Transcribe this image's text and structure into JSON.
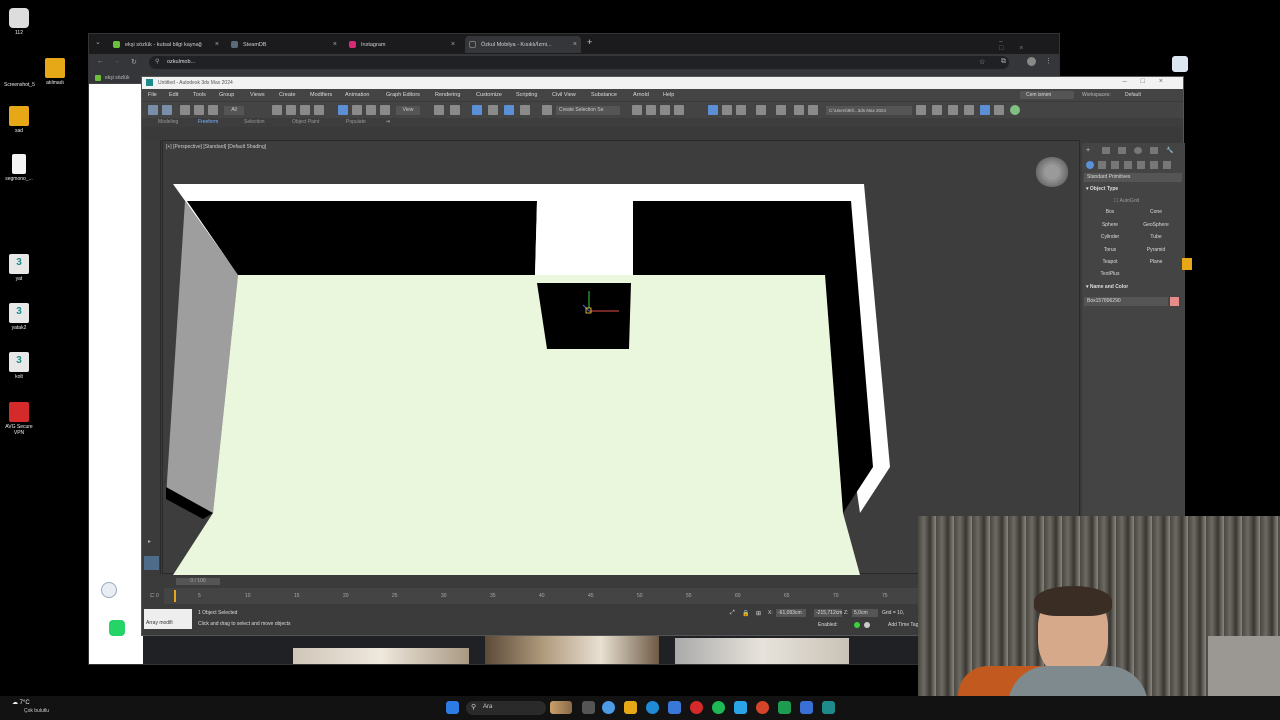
{
  "desktop": {
    "icons": [
      {
        "label": "112",
        "color": "#eeeeee"
      },
      {
        "label": "Screenshot_5",
        "color": "#ffffff"
      },
      {
        "label": "atılmadı",
        "color": "#e6a817"
      },
      {
        "label": "sad",
        "color": "#e6a817"
      },
      {
        "label": "segmono_...",
        "color": "#f4f4f4"
      },
      {
        "label": "yat",
        "color": "#1f8a8a"
      },
      {
        "label": "yatak2",
        "color": "#1f8a8a"
      },
      {
        "label": "kolt",
        "color": "#1f8a8a"
      },
      {
        "label": "AVG Secure VPN",
        "color": "#d42a2a"
      }
    ]
  },
  "browser": {
    "tabs": [
      {
        "label": "ekşi sözlük - kutsal bilgi kaynağ",
        "fav_color": "#6bbf3a"
      },
      {
        "label": "SteamDB",
        "fav_color": "#5b6a7a"
      },
      {
        "label": "Instagram",
        "fav_color": "#d62976"
      },
      {
        "label": "Özkul Mobilya - Kısıklı/İzmi...",
        "fav_color": "#333333"
      }
    ],
    "new_tab": "+",
    "address": "ozkulmob...",
    "bookmark": "ekşi sözlük"
  },
  "max": {
    "title": "Untitled - Autodesk 3ds Max 2024",
    "menus": [
      "File",
      "Edit",
      "Tools",
      "Group",
      "Views",
      "Create",
      "Modifiers",
      "Animation",
      "Graph Editors",
      "Rendering",
      "Customize",
      "Scripting",
      "Civil View",
      "Substance",
      "Arnold",
      "Help"
    ],
    "user": "Cem ismen",
    "workspaces_label": "Workspaces:",
    "workspace": "Default",
    "view_dropdown": "View",
    "selection_set": "Create Selection Se",
    "path": "C:\\Users\\90\\...3ds Max 2024",
    "ribbon_tabs": [
      "Modeling",
      "Freeform",
      "Selection",
      "Object Paint",
      "Populate"
    ],
    "viewport_label": "[+] [Perspective] [Standard] [Default Shading]",
    "panel": {
      "category": "Standard Primitives",
      "object_type": "Object Type",
      "autogrid": "AutoGrid",
      "primitives": [
        "Box",
        "Cone",
        "Sphere",
        "GeoSphere",
        "Cylinder",
        "Tube",
        "Torus",
        "Pyramid",
        "Teapot",
        "Plane",
        "TextPlus"
      ],
      "name_color": "Name and Color",
      "object_name": "Box157896290",
      "swatch_color": "#e88b8b"
    },
    "timeline": {
      "frame": "0 / 100",
      "ticks": [
        "0",
        "5",
        "10",
        "15",
        "20",
        "25",
        "30",
        "35",
        "40",
        "45",
        "50",
        "55",
        "60",
        "65",
        "70",
        "75"
      ]
    },
    "status": {
      "maxscript": "Array modifi",
      "selected": "1 Object Selected",
      "hint": "Click and drag to select and move objects",
      "x_label": "X:",
      "x_value": "-61,093cm",
      "y_value": "-215,712cm",
      "z_label": "Z:",
      "z_value": "5,0cm",
      "grid": "Grid = 10,",
      "enabled": "Enabled:",
      "add_time_tag": "Add Time Tag"
    }
  },
  "taskbar": {
    "weather": "7°C",
    "weather_desc": "Çok bulutlu",
    "search": "Ara"
  }
}
